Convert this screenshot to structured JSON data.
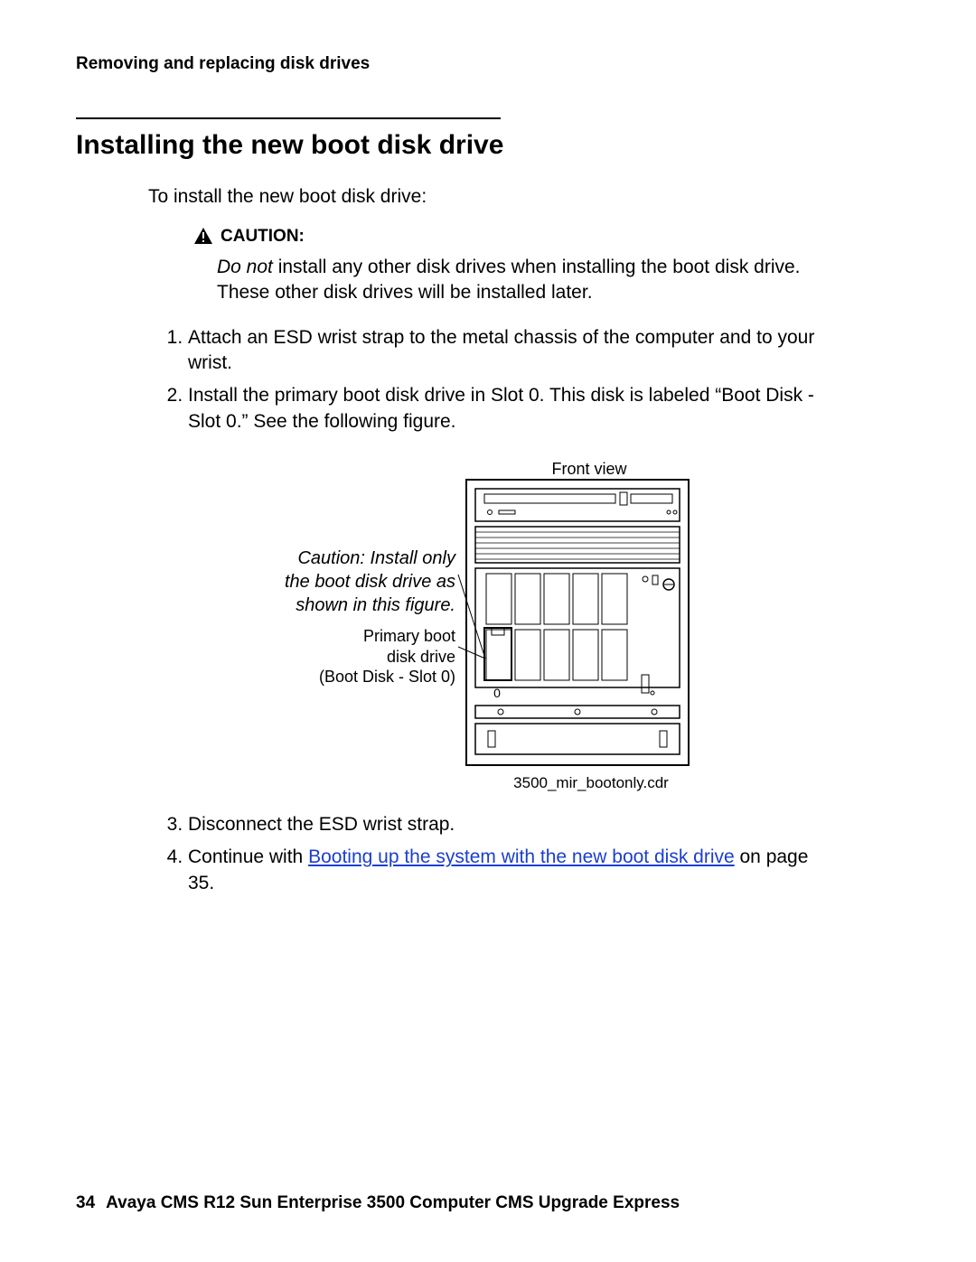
{
  "header": {
    "section": "Removing and replacing disk drives"
  },
  "title": "Installing the new boot disk drive",
  "intro": "To install the new boot disk drive:",
  "caution": {
    "label": "CAUTION:",
    "emph": "Do not",
    "body_rest": " install any other disk drives when installing the boot disk drive. These other disk drives will be installed later."
  },
  "steps_upper": [
    {
      "text": "Attach an ESD wrist strap to the metal chassis of the computer and to your wrist."
    },
    {
      "text": "Install the primary boot disk drive in Slot 0. This disk is labeled “Boot Disk - Slot 0.” See the following figure."
    }
  ],
  "figure": {
    "title": "Front view",
    "annot_italic": "Caution: Install only the boot disk drive as shown in this figure.",
    "annot_plain_l1": "Primary boot",
    "annot_plain_l2": "disk drive",
    "annot_plain_l3": "(Boot Disk - Slot 0)",
    "slot_label": "0",
    "file": "3500_mir_bootonly.cdr"
  },
  "steps_lower": [
    {
      "n": "3",
      "text": "Disconnect the ESD wrist strap."
    },
    {
      "n": "4",
      "prefix": "Continue with ",
      "link": "Booting up the system with the new boot disk drive",
      "suffix": " on page 35."
    }
  ],
  "footer": {
    "page": "34",
    "book": "Avaya CMS R12 Sun Enterprise 3500 Computer CMS Upgrade Express"
  }
}
